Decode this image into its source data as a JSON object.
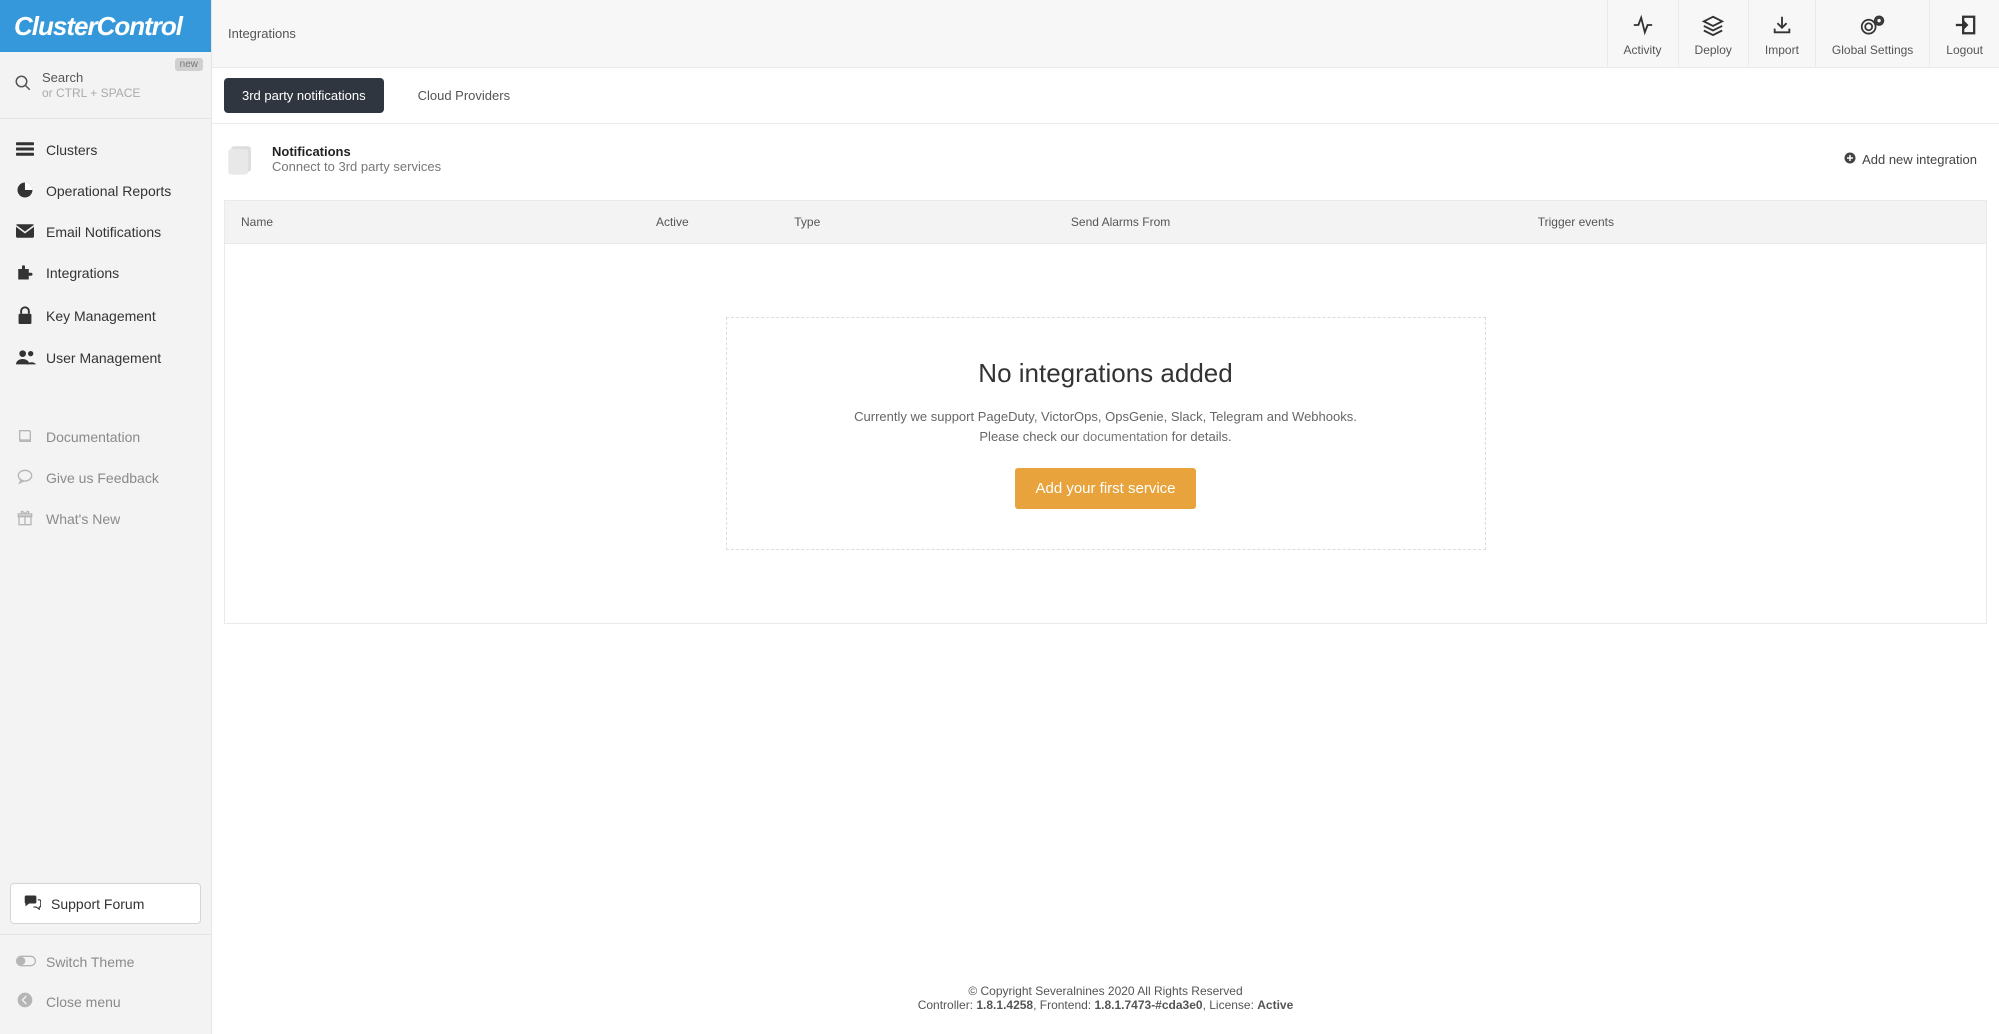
{
  "brand": "ClusterControl",
  "breadcrumb": "Integrations",
  "search": {
    "label": "Search",
    "hint": "or CTRL + SPACE",
    "badge": "new"
  },
  "nav": {
    "primary": [
      {
        "label": "Clusters"
      },
      {
        "label": "Operational Reports"
      },
      {
        "label": "Email Notifications"
      },
      {
        "label": "Integrations"
      },
      {
        "label": "Key Management"
      },
      {
        "label": "User Management"
      }
    ],
    "secondary": [
      {
        "label": "Documentation"
      },
      {
        "label": "Give us Feedback"
      },
      {
        "label": "What's New"
      }
    ],
    "bottom": {
      "support": "Support Forum",
      "theme": "Switch Theme",
      "close": "Close menu"
    }
  },
  "topActions": [
    {
      "label": "Activity"
    },
    {
      "label": "Deploy"
    },
    {
      "label": "Import"
    },
    {
      "label": "Global Settings"
    },
    {
      "label": "Logout"
    }
  ],
  "tabs": [
    {
      "label": "3rd party notifications",
      "active": true
    },
    {
      "label": "Cloud Providers",
      "active": false
    }
  ],
  "section": {
    "title": "Notifications",
    "subtitle": "Connect to 3rd party services",
    "add_link": "Add new integration"
  },
  "table": {
    "columns": [
      "Name",
      "Active",
      "Type",
      "Send Alarms From",
      "Trigger events"
    ]
  },
  "empty": {
    "title": "No integrations added",
    "line1": "Currently we support PageDuty, VictorOps, OpsGenie, Slack, Telegram and Webhooks.",
    "line2_pre": "Please check our ",
    "line2_link": "documentation",
    "line2_post": " for details.",
    "button": "Add your first service"
  },
  "footer": {
    "copyright": "© Copyright Severalnines 2020 All Rights Reserved",
    "controller_label": "Controller: ",
    "controller_ver": "1.8.1.4258",
    "frontend_label": ", Frontend: ",
    "frontend_ver": "1.8.1.7473-#cda3e0",
    "license_label": ", License: ",
    "license_status": "Active"
  }
}
